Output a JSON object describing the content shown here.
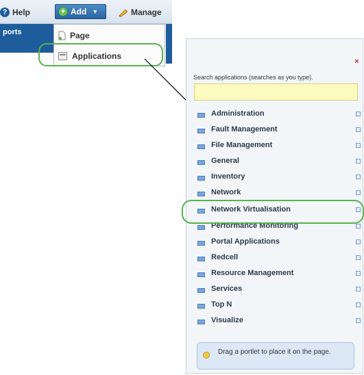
{
  "toolbar": {
    "help_label": "Help",
    "add_label": "Add",
    "manage_label": "Manage",
    "help_icon": "?",
    "add_icon": "+",
    "caret": "▼"
  },
  "left_strip": {
    "label": "ports"
  },
  "add_menu": {
    "items": [
      {
        "label": "Page"
      },
      {
        "label": "Applications"
      }
    ]
  },
  "panel": {
    "close_icon": "×",
    "search_label": "Search applications (searches as you type).",
    "search_value": "",
    "search_placeholder": "",
    "categories": [
      {
        "label": "Administration"
      },
      {
        "label": "Fault Management"
      },
      {
        "label": "File Management"
      },
      {
        "label": "General"
      },
      {
        "label": "Inventory"
      },
      {
        "label": "Network"
      },
      {
        "label": "Network Virtualisation"
      },
      {
        "label": "Performance Monitoring"
      },
      {
        "label": "Portal Applications"
      },
      {
        "label": "Redcell"
      },
      {
        "label": "Resource Management"
      },
      {
        "label": "Services"
      },
      {
        "label": "Top N"
      },
      {
        "label": "Visualize"
      }
    ],
    "tip_text": "Drag a portlet to place it on the page."
  },
  "colors": {
    "accent_blue": "#1f5c9b",
    "highlight_green": "#55b34a",
    "search_yellow": "#fdfbbf",
    "tip_blue": "#dce8f6"
  }
}
